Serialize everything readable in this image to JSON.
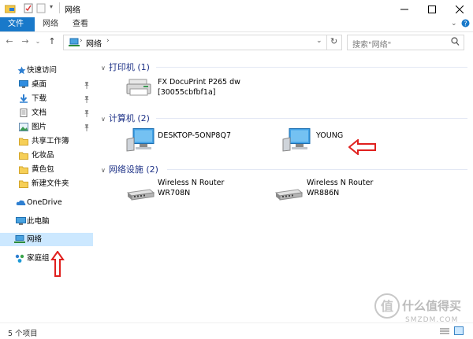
{
  "window": {
    "title": "网络",
    "minimize": "minimize",
    "maximize": "maximize",
    "close": "close"
  },
  "ribbon": {
    "tabs": [
      {
        "label": "文件",
        "active": true
      },
      {
        "label": "网络",
        "active": false
      },
      {
        "label": "查看",
        "active": false
      }
    ]
  },
  "address": {
    "crumb": "网络",
    "search_placeholder": "搜索\"网络\""
  },
  "nav": {
    "quick_access": "快速访问",
    "items": [
      {
        "label": "桌面",
        "icon": "desktop-icon",
        "pinned": true
      },
      {
        "label": "下载",
        "icon": "download-icon",
        "pinned": true
      },
      {
        "label": "文档",
        "icon": "document-icon",
        "pinned": true
      },
      {
        "label": "图片",
        "icon": "pictures-icon",
        "pinned": true
      },
      {
        "label": "共享工作簿",
        "icon": "folder-icon",
        "pinned": false
      },
      {
        "label": "化妆品",
        "icon": "folder-icon",
        "pinned": false
      },
      {
        "label": "黄色包",
        "icon": "folder-icon",
        "pinned": false
      },
      {
        "label": "新建文件夹",
        "icon": "folder-icon",
        "pinned": false
      }
    ],
    "onedrive": "OneDrive",
    "this_pc": "此电脑",
    "network": "网络",
    "homegroup": "家庭组"
  },
  "content": {
    "groups": [
      {
        "title": "打印机 (1)",
        "items": [
          {
            "line1": "FX DocuPrint P265 dw",
            "line2": "[30055cbfbf1a]",
            "icon": "printer-icon"
          }
        ]
      },
      {
        "title": "计算机 (2)",
        "items": [
          {
            "line1": "DESKTOP-5ONP8Q7",
            "line2": "",
            "icon": "computer-icon"
          },
          {
            "line1": "YOUNG",
            "line2": "",
            "icon": "computer-icon"
          }
        ]
      },
      {
        "title": "网络设施 (2)",
        "items": [
          {
            "line1": "Wireless N Router",
            "line2": "WR708N",
            "icon": "router-icon"
          },
          {
            "line1": "Wireless N Router",
            "line2": "WR886N",
            "icon": "router-icon"
          }
        ]
      }
    ]
  },
  "status": {
    "count": "5 个项目"
  },
  "watermark": {
    "text": "什么值得买",
    "sub": "SMZDM.COM"
  },
  "colors": {
    "accent": "#1979ca",
    "selected": "#cce8ff",
    "group_title": "#1e3287",
    "annotation": "#e0201e"
  }
}
